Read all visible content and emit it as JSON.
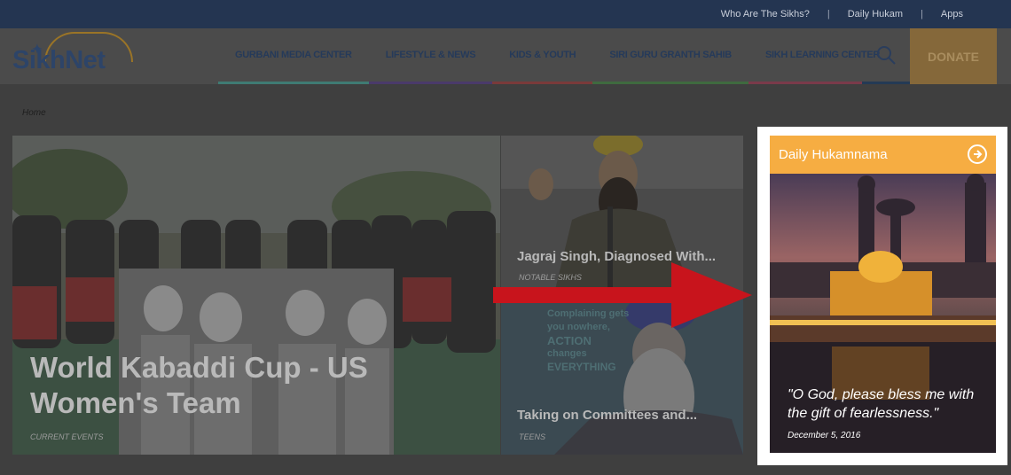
{
  "topbar": {
    "links": [
      "Who Are The Sikhs?",
      "Daily Hukam",
      "Apps"
    ]
  },
  "header": {
    "logo": "SikhNet",
    "nav": [
      {
        "label": "GURBANI MEDIA CENTER",
        "color": "#3f7b73"
      },
      {
        "label": "LIFESTYLE & NEWS",
        "color": "#4a3a6a"
      },
      {
        "label": "KIDS & YOUTH",
        "color": "#7a3a3a"
      },
      {
        "label": "SIRI GURU GRANTH SAHIB",
        "color": "#3f6a3f"
      },
      {
        "label": "SIKH LEARNING CENTER",
        "color": "#7a3a4a"
      }
    ],
    "donate": "DONATE"
  },
  "breadcrumb": "Home",
  "cards": {
    "main": {
      "title_line1": "World Kabaddi Cup - US",
      "title_line2": "Women's Team",
      "category": "CURRENT EVENTS"
    },
    "side1": {
      "title": "Jagraj Singh, Diagnosed With...",
      "category": "NOTABLE SIKHS"
    },
    "side2": {
      "title": "Taking on Committees and...",
      "category": "TEENS",
      "poster_lines": [
        "Complaining gets",
        "you nowhere,",
        "ACTION",
        "changes",
        "EVERYTHING"
      ]
    }
  },
  "hukamnama": {
    "heading": "Daily Hukamnama",
    "quote_line1": "\"O God, please bless me with",
    "quote_line2": "the gift of fearlessness.\"",
    "date": "December 5, 2016"
  },
  "colors": {
    "arrow": "#c8141c",
    "hukam_header": "#f6ad42",
    "topbar": "#243551"
  }
}
